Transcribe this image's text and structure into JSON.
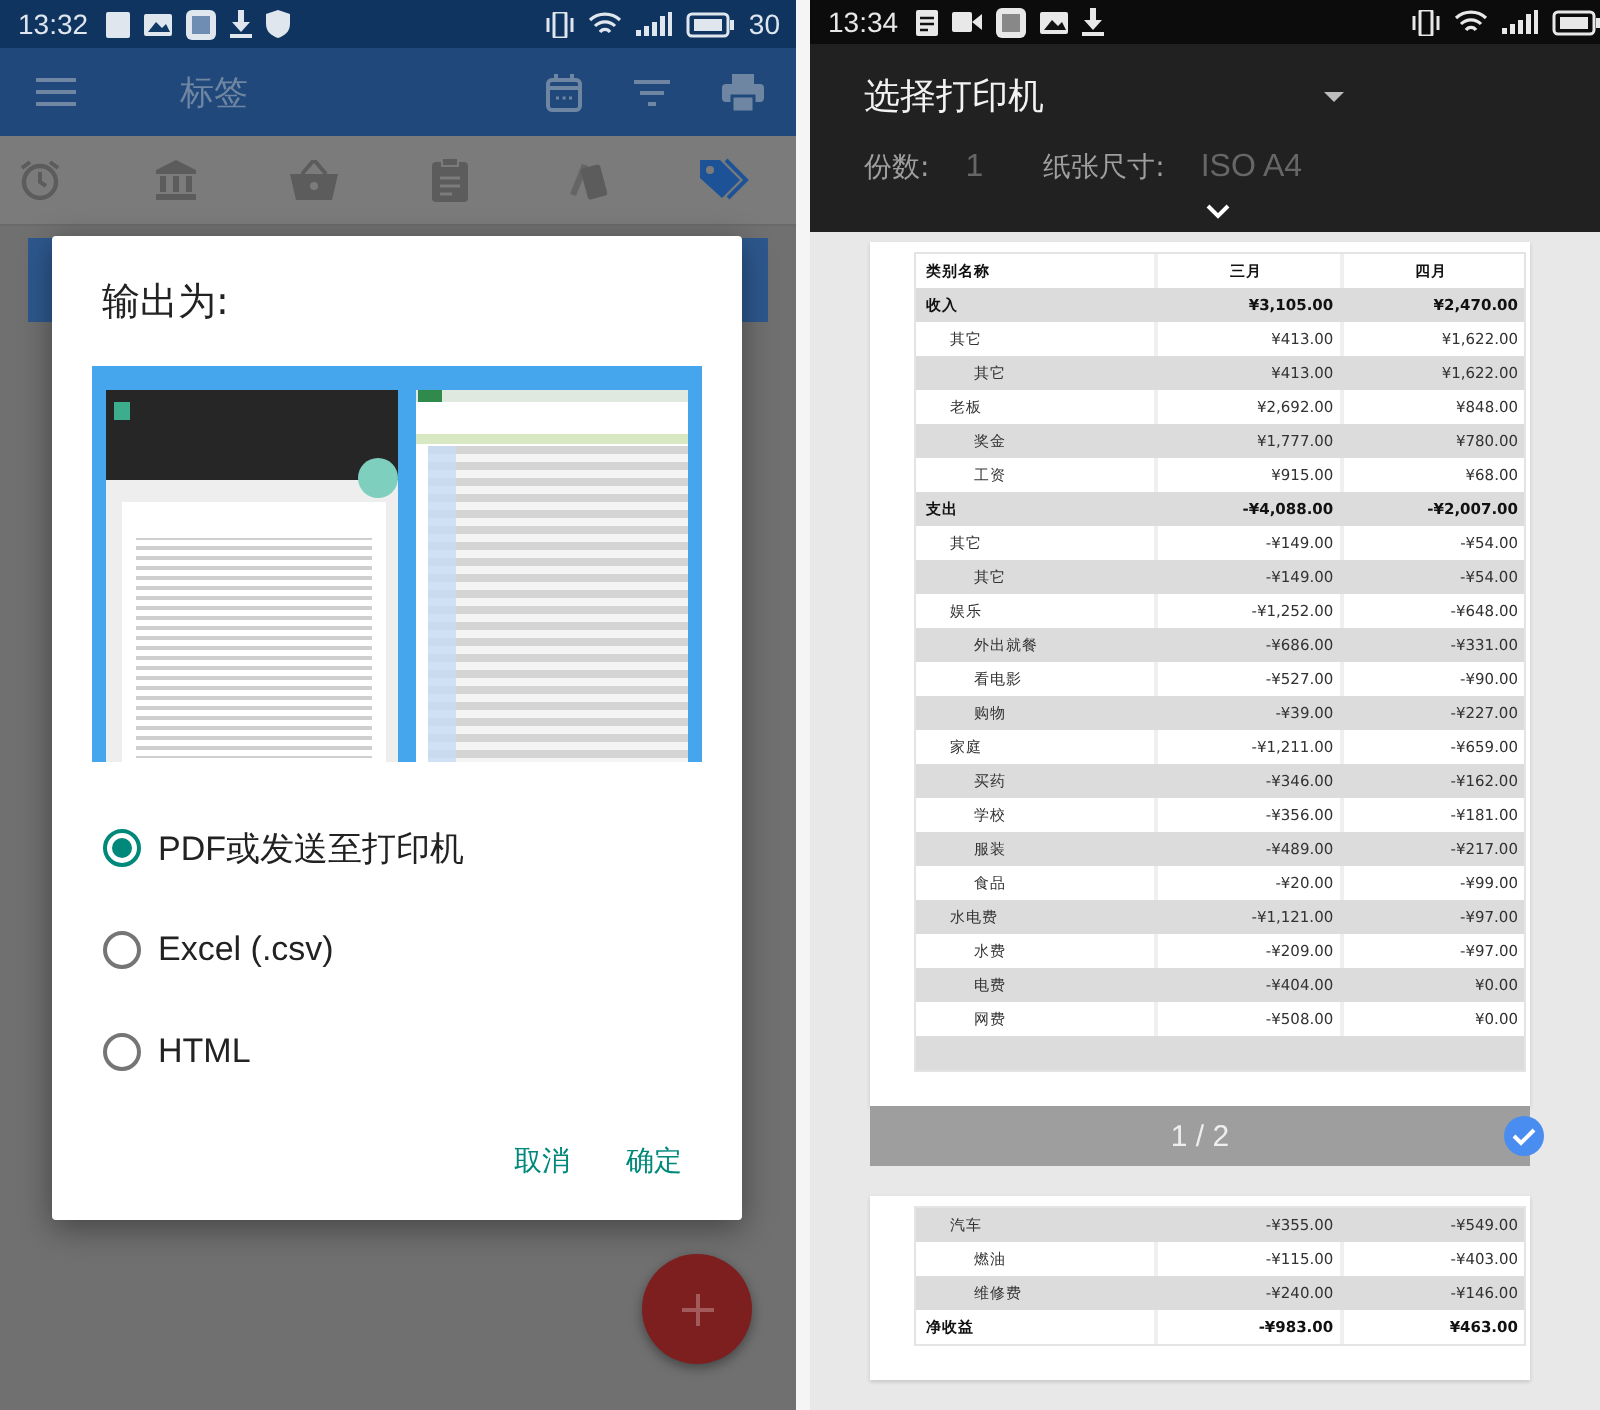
{
  "left_screen": {
    "status_bar": {
      "time": "13:32",
      "battery": "30"
    },
    "app_bar": {
      "title": "标签"
    },
    "tabs": [
      {
        "selected": false
      },
      {
        "selected": false
      },
      {
        "selected": false
      },
      {
        "selected": false
      },
      {
        "selected": false
      },
      {
        "selected": true
      }
    ],
    "dialog": {
      "title": "输出为:",
      "options": [
        {
          "label": "PDF或发送至打印机",
          "selected": true
        },
        {
          "label": "Excel (.csv)",
          "selected": false
        },
        {
          "label": "HTML",
          "selected": false
        }
      ],
      "buttons": [
        "取消",
        "确定"
      ]
    }
  },
  "right_screen": {
    "status_bar": {
      "time": "13:34"
    },
    "header": {
      "printer": "选择打印机",
      "copies_label": "份数:",
      "copies": "1",
      "paper_label": "纸张尺寸:",
      "paper": "ISO A4"
    },
    "pages": [
      {
        "columns": [
          "类别名称",
          "三月",
          "四月"
        ],
        "rows": [
          {
            "label": "收入",
            "march": "¥3,105.00",
            "april": "¥2,470.00",
            "children": [
              {
                "label": "其它",
                "march": "¥413.00",
                "april": "¥1,622.00",
                "children": [
                  {
                    "label": "其它",
                    "march": "¥413.00",
                    "april": "¥1,622.00"
                  }
                ]
              },
              {
                "label": "老板",
                "march": "¥2,692.00",
                "april": "¥848.00",
                "children": [
                  {
                    "label": "奖金",
                    "march": "¥1,777.00",
                    "april": "¥780.00"
                  },
                  {
                    "label": "工资",
                    "march": "¥915.00",
                    "april": "¥68.00"
                  }
                ]
              }
            ]
          },
          {
            "label": "支出",
            "march": "-¥4,088.00",
            "april": "-¥2,007.00",
            "children": [
              {
                "label": "其它",
                "march": "-¥149.00",
                "april": "-¥54.00",
                "children": [
                  {
                    "label": "其它",
                    "march": "-¥149.00",
                    "april": "-¥54.00"
                  }
                ]
              },
              {
                "label": "娱乐",
                "march": "-¥1,252.00",
                "april": "-¥648.00",
                "children": [
                  {
                    "label": "外出就餐",
                    "march": "-¥686.00",
                    "april": "-¥331.00"
                  },
                  {
                    "label": "看电影",
                    "march": "-¥527.00",
                    "april": "-¥90.00"
                  },
                  {
                    "label": "购物",
                    "march": "-¥39.00",
                    "april": "-¥227.00"
                  }
                ]
              },
              {
                "label": "家庭",
                "march": "-¥1,211.00",
                "april": "-¥659.00",
                "children": [
                  {
                    "label": "买药",
                    "march": "-¥346.00",
                    "april": "-¥162.00"
                  },
                  {
                    "label": "学校",
                    "march": "-¥356.00",
                    "april": "-¥181.00"
                  },
                  {
                    "label": "服装",
                    "march": "-¥489.00",
                    "april": "-¥217.00"
                  },
                  {
                    "label": "食品",
                    "march": "-¥20.00",
                    "april": "-¥99.00"
                  }
                ]
              },
              {
                "label": "水电费",
                "march": "-¥1,121.00",
                "april": "-¥97.00",
                "children": [
                  {
                    "label": "水费",
                    "march": "-¥209.00",
                    "april": "-¥97.00"
                  },
                  {
                    "label": "电费",
                    "march": "-¥404.00",
                    "april": "¥0.00"
                  },
                  {
                    "label": "网费",
                    "march": "-¥508.00",
                    "april": "¥0.00"
                  }
                ]
              }
            ]
          }
        ],
        "page_number": "1 / 2",
        "selected": true
      },
      {
        "rows": [
          {
            "children": [
              {
                "label": "汽车",
                "march": "-¥355.00",
                "april": "-¥549.00",
                "children": [
                  {
                    "label": "燃油",
                    "march": "-¥115.00",
                    "april": "-¥403.00"
                  },
                  {
                    "label": "维修费",
                    "march": "-¥240.00",
                    "april": "-¥146.00"
                  }
                ]
              }
            ]
          },
          {
            "label": "净收益",
            "march": "-¥983.00",
            "april": "¥463.00"
          }
        ]
      }
    ]
  }
}
